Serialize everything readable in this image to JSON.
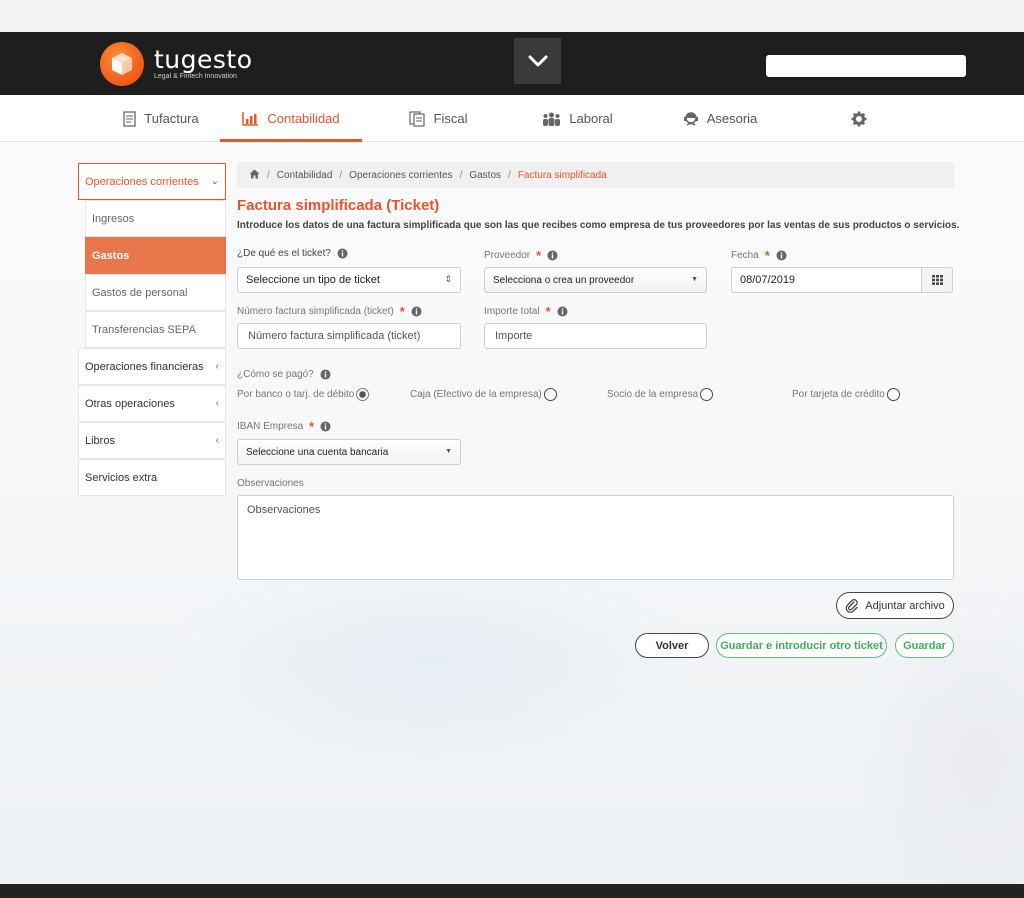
{
  "brand": {
    "name": "tugesto",
    "tagline": "Legal & Fintech Innovation"
  },
  "nav": {
    "items": [
      {
        "label": "Tufactura",
        "icon": "invoice-icon"
      },
      {
        "label": "Contabilidad",
        "icon": "chart-icon",
        "active": true
      },
      {
        "label": "Fiscal",
        "icon": "documents-icon"
      },
      {
        "label": "Laboral",
        "icon": "people-icon"
      },
      {
        "label": "Asesoria",
        "icon": "advisor-icon"
      },
      {
        "label": "",
        "icon": "gear-icon"
      }
    ]
  },
  "sidebar": {
    "items": [
      {
        "label": "Operaciones corrientes",
        "chevron": "⌄"
      },
      {
        "label": "Ingresos"
      },
      {
        "label": "Gastos"
      },
      {
        "label": "Gastos de personal"
      },
      {
        "label": "Transferencias SEPA"
      },
      {
        "label": "Operaciones financieras",
        "chevron": "‹"
      },
      {
        "label": "Otras operaciones",
        "chevron": "‹"
      },
      {
        "label": "Libros",
        "chevron": "‹"
      },
      {
        "label": "Servicios extra"
      }
    ]
  },
  "breadcrumb": [
    "Contabilidad",
    "Operaciones corrientes",
    "Gastos",
    "Factura simplificada"
  ],
  "page": {
    "title": "Factura simplificada (Ticket)",
    "description": "Introduce los datos de una factura simplificada que son las que recibes como empresa de tus proveedores por las ventas de sus productos o servicios."
  },
  "form": {
    "ticket_type": {
      "label": "¿De qué es el ticket?",
      "value": "Seleccione un tipo de ticket"
    },
    "supplier": {
      "label": "Proveedor",
      "value": "Selecciona o crea un proveedor"
    },
    "date": {
      "label": "Fecha",
      "value": "08/07/2019"
    },
    "invoice_number": {
      "label": "Número factura simplificada (ticket)",
      "placeholder": "Número factura simplificada (ticket)"
    },
    "total": {
      "label": "Importe total",
      "placeholder": "Importe"
    },
    "payment": {
      "label": "¿Cómo se pagó?",
      "options": [
        "Por banco o tarj. de débito",
        "Caja (Efectivo de la empresa)",
        "Socio de la empresa",
        "Por tarjeta de crédito"
      ]
    },
    "iban": {
      "label": "IBAN Empresa",
      "value": "Seleccione una cuenta bancaria"
    },
    "notes": {
      "label": "Observaciones",
      "placeholder": "Observaciones"
    }
  },
  "buttons": {
    "attach": "Adjuntar archivo",
    "back": "Volver",
    "save_new": "Guardar e introducir otro ticket",
    "save": "Guardar"
  },
  "colors": {
    "accent": "#e8552a",
    "green": "#3fae62",
    "dark": "#1e1e1e"
  }
}
